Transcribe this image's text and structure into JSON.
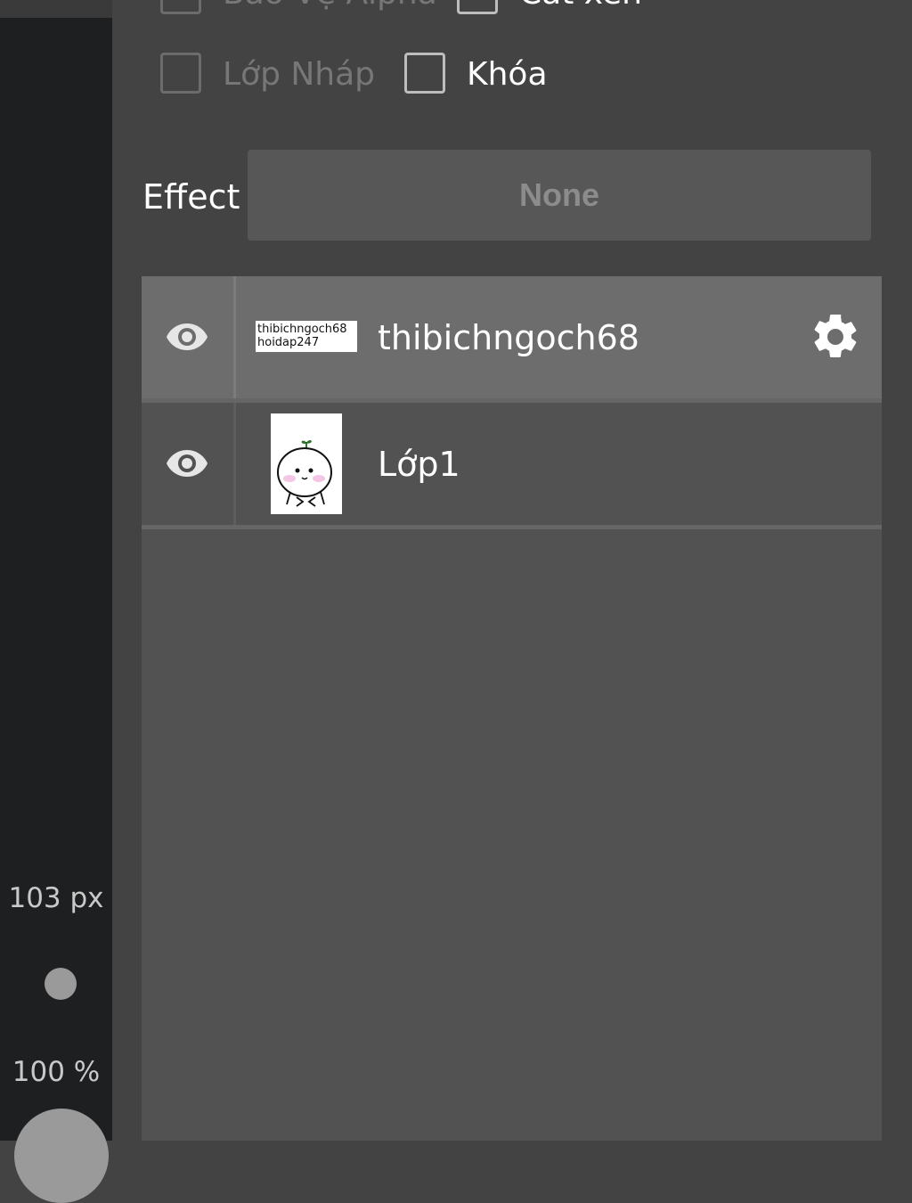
{
  "sidebar": {
    "brush_size": "103 px",
    "opacity": "100 %"
  },
  "options": {
    "row1": [
      {
        "label": "Bảo Vệ Alpha",
        "checked": false,
        "enabled": false
      },
      {
        "label": "Cắt xén",
        "checked": false,
        "enabled": true
      }
    ],
    "row2": [
      {
        "label": "Lớp Nháp",
        "checked": false,
        "enabled": false
      },
      {
        "label": "Khóa",
        "checked": false,
        "enabled": true
      }
    ]
  },
  "effect": {
    "label": "Effect",
    "value": "None"
  },
  "layers": [
    {
      "name": "thibichngoch68",
      "thumbnail_text": [
        "thibichngoch68",
        "hoidap247"
      ],
      "selected": true,
      "visible": true
    },
    {
      "name": "Lớp1",
      "selected": false,
      "visible": true
    }
  ],
  "icons": {
    "eye": "eye-icon",
    "gear": "gear-icon"
  },
  "colors": {
    "panel_bg": "#434343",
    "sidebar_bg": "#1e1f21",
    "selected_layer": "#6d6d6d",
    "layer_bg": "#525252"
  }
}
